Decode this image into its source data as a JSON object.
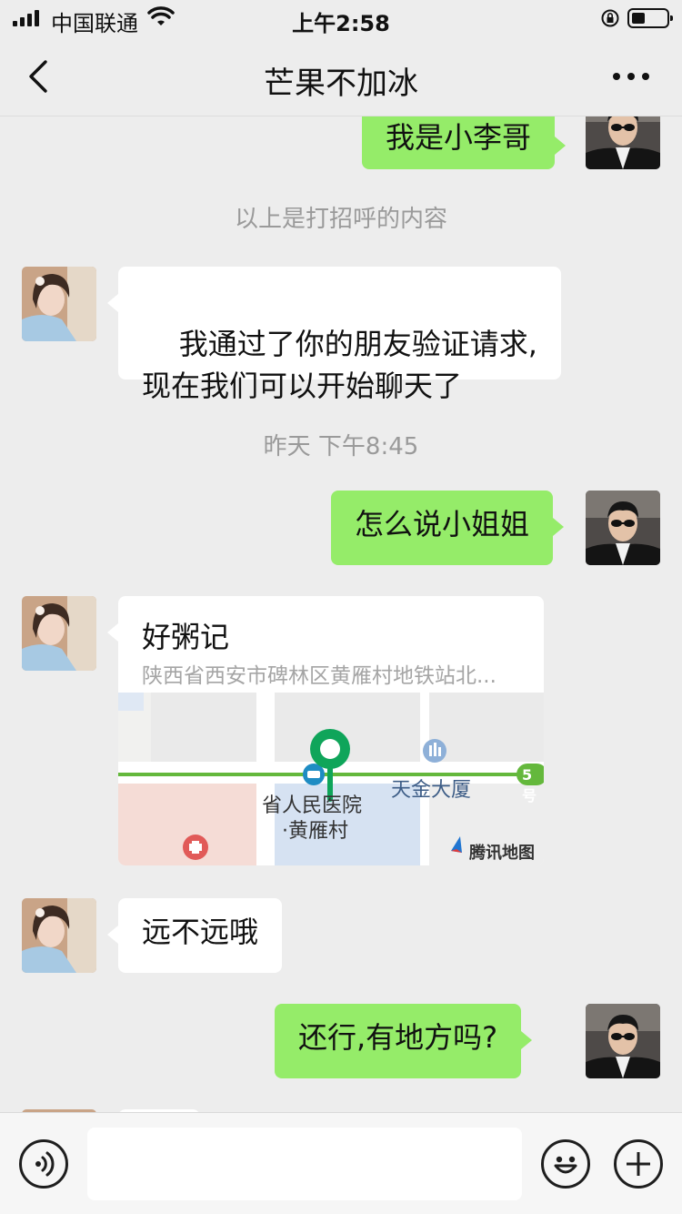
{
  "status": {
    "carrier": "中国联通",
    "time": "上午2:58"
  },
  "nav": {
    "title": "芒果不加冰"
  },
  "messages": {
    "m1": "我是小李哥",
    "sys1": "以上是打招呼的内容",
    "m2": "我通过了你的朋友验证请求,\n现在我们可以开始聊天了",
    "time1": "昨天 下午8:45",
    "m3": "怎么说小姐姐",
    "location": {
      "name": "好粥记",
      "address": "陕西省西安市碑林区黄雁村地铁站北...",
      "map_labels": {
        "hospital": "省人民医院",
        "station": "·黄雁村",
        "building": "天金大厦",
        "line": "5号",
        "brand": "腾讯地图"
      }
    },
    "m4": "远不远哦",
    "m5": "还行,有地方吗?"
  },
  "icons": {
    "back": "chevron-left-icon",
    "more": "ellipsis-icon",
    "voice": "voice-icon",
    "emoji": "emoji-icon",
    "add": "plus-icon"
  },
  "colors": {
    "sent_bubble": "#95ec69",
    "received_bubble": "#ffffff",
    "background": "#ededed",
    "pin": "#07c160"
  }
}
